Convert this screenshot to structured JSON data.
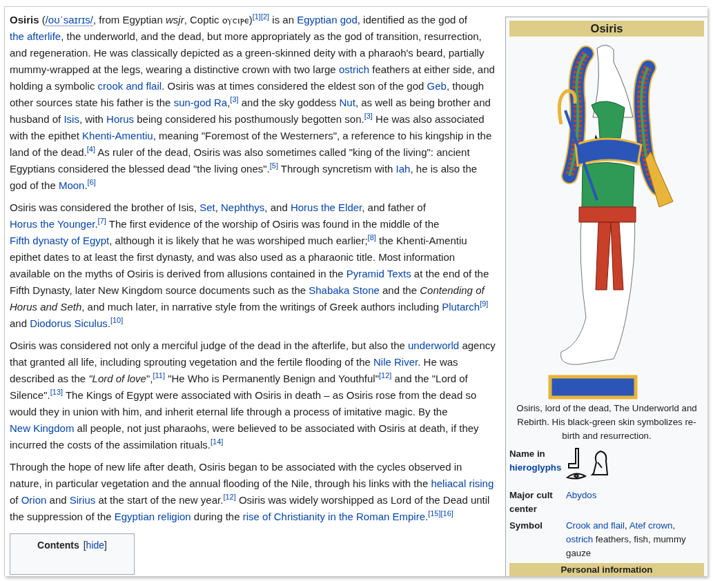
{
  "article": {
    "paragraphs": [
      {
        "segments": [
          {
            "text": "Osiris",
            "kind": "bold"
          },
          {
            "text": " (",
            "kind": "plain"
          },
          {
            "text": "/oʊˈsaɪrɪs/",
            "kind": "ipa"
          },
          {
            "text": ", from Egyptian ",
            "kind": "plain"
          },
          {
            "text": "wsjr",
            "kind": "italic"
          },
          {
            "text": ", Coptic ⲟⲩⲥⲓⲣⲉ)",
            "kind": "plain"
          },
          {
            "text": "[1]",
            "kind": "ref"
          },
          {
            "text": "[2]",
            "kind": "ref"
          },
          {
            "text": " is an ",
            "kind": "plain"
          },
          {
            "text": "Egyptian god",
            "kind": "link"
          },
          {
            "text": ", identified as the god of ",
            "kind": "plain"
          },
          {
            "text": "the afterlife",
            "kind": "link"
          },
          {
            "text": ", the underworld, and the dead, but more appropriately as the god of transition, resurrection, and regeneration. He was classically depicted as a green-skinned deity with a pharaoh's beard, partially mummy-wrapped at the legs, wearing a distinctive crown with two large ",
            "kind": "plain"
          },
          {
            "text": "ostrich",
            "kind": "link"
          },
          {
            "text": " feathers at either side, and holding a symbolic ",
            "kind": "plain"
          },
          {
            "text": "crook and flail",
            "kind": "link"
          },
          {
            "text": ". Osiris was at times considered the eldest son of the god ",
            "kind": "plain"
          },
          {
            "text": "Geb",
            "kind": "link"
          },
          {
            "text": ", though other sources state his father is the ",
            "kind": "plain"
          },
          {
            "text": "sun-god Ra",
            "kind": "link"
          },
          {
            "text": ",",
            "kind": "plain"
          },
          {
            "text": "[3]",
            "kind": "ref"
          },
          {
            "text": " and the sky goddess ",
            "kind": "plain"
          },
          {
            "text": "Nut",
            "kind": "link"
          },
          {
            "text": ", as well as being brother and husband of ",
            "kind": "plain"
          },
          {
            "text": "Isis",
            "kind": "link"
          },
          {
            "text": ", with ",
            "kind": "plain"
          },
          {
            "text": "Horus",
            "kind": "link"
          },
          {
            "text": " being considered his posthumously begotten son.",
            "kind": "plain"
          },
          {
            "text": "[3]",
            "kind": "ref"
          },
          {
            "text": " He was also associated with the epithet ",
            "kind": "plain"
          },
          {
            "text": "Khenti-Amentiu",
            "kind": "link"
          },
          {
            "text": ", meaning \"Foremost of the Westerners\", a reference to his kingship in the land of the dead.",
            "kind": "plain"
          },
          {
            "text": "[4]",
            "kind": "ref"
          },
          {
            "text": " As ruler of the dead, Osiris was also sometimes called \"king of the living\": ancient Egyptians considered the blessed dead \"the living ones\".",
            "kind": "plain"
          },
          {
            "text": "[5]",
            "kind": "ref"
          },
          {
            "text": " Through syncretism with ",
            "kind": "plain"
          },
          {
            "text": "Iah",
            "kind": "link"
          },
          {
            "text": ", he is also the god of the ",
            "kind": "plain"
          },
          {
            "text": "Moon",
            "kind": "link"
          },
          {
            "text": ".",
            "kind": "plain"
          },
          {
            "text": "[6]",
            "kind": "ref"
          }
        ]
      },
      {
        "segments": [
          {
            "text": "Osiris was considered the brother of Isis, ",
            "kind": "plain"
          },
          {
            "text": "Set",
            "kind": "link"
          },
          {
            "text": ", ",
            "kind": "plain"
          },
          {
            "text": "Nephthys",
            "kind": "link"
          },
          {
            "text": ", and ",
            "kind": "plain"
          },
          {
            "text": "Horus the Elder",
            "kind": "link"
          },
          {
            "text": ", and father of ",
            "kind": "plain"
          },
          {
            "text": "Horus the Younger",
            "kind": "link"
          },
          {
            "text": ".",
            "kind": "plain"
          },
          {
            "text": "[7]",
            "kind": "ref"
          },
          {
            "text": " The first evidence of the worship of Osiris was found in the middle of the ",
            "kind": "plain"
          },
          {
            "text": "Fifth dynasty of Egypt",
            "kind": "link"
          },
          {
            "text": ", although it is likely that he was worshiped much earlier;",
            "kind": "plain"
          },
          {
            "text": "[8]",
            "kind": "ref"
          },
          {
            "text": " the Khenti-Amentiu epithet dates to at least the first dynasty, and was also used as a pharaonic title. Most information available on the myths of Osiris is derived from allusions contained in the ",
            "kind": "plain"
          },
          {
            "text": "Pyramid Texts",
            "kind": "link"
          },
          {
            "text": " at the end of the Fifth Dynasty, later New Kingdom source documents such as the ",
            "kind": "plain"
          },
          {
            "text": "Shabaka Stone",
            "kind": "link"
          },
          {
            "text": " and the ",
            "kind": "plain"
          },
          {
            "text": "Contending of Horus and Seth",
            "kind": "italic"
          },
          {
            "text": ", and much later, in narrative style from the writings of Greek authors including ",
            "kind": "plain"
          },
          {
            "text": "Plutarch",
            "kind": "link"
          },
          {
            "text": "[9]",
            "kind": "ref"
          },
          {
            "text": " and ",
            "kind": "plain"
          },
          {
            "text": "Diodorus Siculus",
            "kind": "link"
          },
          {
            "text": ".",
            "kind": "plain"
          },
          {
            "text": "[10]",
            "kind": "ref"
          }
        ]
      },
      {
        "segments": [
          {
            "text": "Osiris was considered not only a merciful judge of the dead in the afterlife, but also the ",
            "kind": "plain"
          },
          {
            "text": "underworld",
            "kind": "link"
          },
          {
            "text": " agency that granted all life, including sprouting vegetation and the fertile flooding of the ",
            "kind": "plain"
          },
          {
            "text": "Nile River",
            "kind": "link"
          },
          {
            "text": ". He was described as the ",
            "kind": "plain"
          },
          {
            "text": "\"Lord of love",
            "kind": "italic"
          },
          {
            "text": "\",",
            "kind": "plain"
          },
          {
            "text": "[11]",
            "kind": "ref"
          },
          {
            "text": " \"He Who is Permanently Benign and Youthful\"",
            "kind": "plain"
          },
          {
            "text": "[12]",
            "kind": "ref"
          },
          {
            "text": " and the \"Lord of Silence\".",
            "kind": "plain"
          },
          {
            "text": "[13]",
            "kind": "ref"
          },
          {
            "text": " The Kings of Egypt were associated with Osiris in death – as Osiris rose from the dead so would they in union with him, and inherit eternal life through a process of imitative magic. By the ",
            "kind": "plain"
          },
          {
            "text": "New Kingdom",
            "kind": "link"
          },
          {
            "text": " all people, not just pharaohs, were believed to be associated with Osiris at death, if they incurred the costs of the assimilation rituals.",
            "kind": "plain"
          },
          {
            "text": "[14]",
            "kind": "ref"
          }
        ]
      },
      {
        "segments": [
          {
            "text": "Through the hope of new life after death, Osiris began to be associated with the cycles observed in nature, in particular vegetation and the annual flooding of the Nile, through his links with the ",
            "kind": "plain"
          },
          {
            "text": "heliacal rising",
            "kind": "link"
          },
          {
            "text": " of ",
            "kind": "plain"
          },
          {
            "text": "Orion",
            "kind": "link"
          },
          {
            "text": " and ",
            "kind": "plain"
          },
          {
            "text": "Sirius",
            "kind": "link"
          },
          {
            "text": " at the start of the new year.",
            "kind": "plain"
          },
          {
            "text": "[12]",
            "kind": "ref"
          },
          {
            "text": " Osiris was widely worshipped as Lord of the Dead until the suppression of the ",
            "kind": "plain"
          },
          {
            "text": "Egyptian religion",
            "kind": "link"
          },
          {
            "text": " during the ",
            "kind": "plain"
          },
          {
            "text": "rise of Christianity in the Roman Empire",
            "kind": "link"
          },
          {
            "text": ".",
            "kind": "plain"
          },
          {
            "text": "[15]",
            "kind": "ref"
          },
          {
            "text": "[16]",
            "kind": "ref"
          }
        ]
      }
    ],
    "contents": {
      "title": "Contents",
      "toggle": [
        {
          "text": "[",
          "kind": "plain"
        },
        {
          "text": "hide",
          "kind": "link"
        },
        {
          "text": "]",
          "kind": "plain"
        }
      ]
    }
  },
  "infobox": {
    "title": "Osiris",
    "caption": "Osiris, lord of the dead, The Underworld and Rebirth. His black-green skin symbolizes re-birth and resurrection.",
    "rows": [
      {
        "kind": "hieroglyphs",
        "label": [
          {
            "text": "Name in ",
            "kind": "plain"
          },
          {
            "text": "hieroglyphs",
            "kind": "link"
          }
        ]
      },
      {
        "kind": "text",
        "label": [
          {
            "text": "Major cult center",
            "kind": "plain"
          }
        ],
        "value": [
          {
            "text": "Abydos",
            "kind": "link"
          }
        ]
      },
      {
        "kind": "text",
        "label": [
          {
            "text": "Symbol",
            "kind": "plain"
          }
        ],
        "value": [
          {
            "text": "Crook and flail",
            "kind": "link"
          },
          {
            "text": ", ",
            "kind": "plain"
          },
          {
            "text": "Atef crown",
            "kind": "link"
          },
          {
            "text": ", ",
            "kind": "plain"
          },
          {
            "text": "ostrich",
            "kind": "link"
          },
          {
            "text": " feathers, fish, mummy gauze",
            "kind": "plain"
          }
        ]
      },
      {
        "kind": "header",
        "label": [
          {
            "text": "Personal information",
            "kind": "plain"
          }
        ]
      }
    ]
  }
}
